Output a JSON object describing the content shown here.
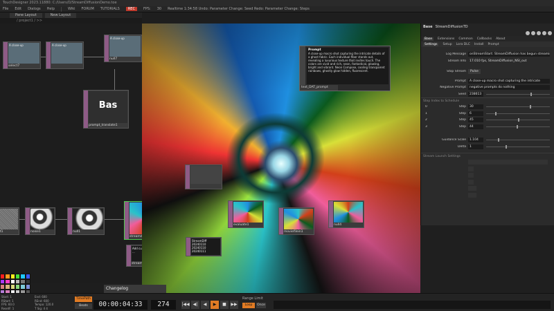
{
  "window": {
    "title": "TouchDesigner 2023.11880: C:/Users/D/StreamDiffusionDemo.toe"
  },
  "menubar": {
    "items": [
      "File",
      "Edit",
      "Dialogs",
      "Help",
      "Wiki",
      "FORUM",
      "TUTORIALS"
    ],
    "tag": "REC",
    "fps_label": "FPS:",
    "fps_value": "30",
    "status": "Realtime  1:34:58 Undo: Parameter Change: Seed  Redo: Parameter Change: Steps"
  },
  "panes": {
    "tab1": "Pane Layout",
    "tab2": "New Layout"
  },
  "path": "/ project1 / >>",
  "nodes": {
    "select7": {
      "text": "A close-up",
      "caption": "select7"
    },
    "select_b": {
      "text": "A close-up",
      "caption": ""
    },
    "null7": {
      "text": "A close-up",
      "caption": "null7"
    },
    "prompt": {
      "text": "Bas",
      "caption": "prompt_translate1"
    },
    "noise_left": {
      "caption": "rt1"
    },
    "noise1": {
      "caption": "noise1"
    },
    "null1": {
      "caption": "null1"
    },
    "streamdiffusion": {
      "caption": "streamdiffusion"
    },
    "callbacks": {
      "caption": "streamdiffusion_callbacks",
      "lines": [
        "Add custom",
        "..."
      ]
    },
    "table_node": {
      "lines": [
        "StreamDiff",
        "20240110",
        "20240110",
        "20240111"
      ]
    },
    "evaluate1": {
      "caption": "evaluate1"
    },
    "movie": {
      "caption": "moviefilein1"
    },
    "null4": {
      "caption": "null4"
    }
  },
  "prompt_doc": {
    "heading": "Prompt",
    "text": "A close-up macro shot capturing the intricate details of a ghost fabric. Each individual fiber stands out, revealing a luxurious texture that invites touch. The colors are vivid and rich, neon, fantastical, glowing, bright and vibrant. Neon Compose, cooling transparent rainbows, ghostly glow hidden, fluorescent.",
    "caption": "text_DAT_prompt"
  },
  "params": {
    "comp_type": "Base",
    "comp_name": "StreamDiffusionTD",
    "tabs": [
      "Base",
      "Extensions",
      "Common",
      "Callbacks",
      "About"
    ],
    "subtabs": [
      "Settings",
      "Setup",
      "Lora DLC",
      "Install",
      "Prompt"
    ],
    "rows": [
      {
        "label": "Log Message",
        "value": "onStreamStart: StreamDiffusion has begun streaming"
      },
      {
        "label": "Stream Info",
        "value": "17.010 fps, StreamDiffusion_NSI_out"
      },
      {
        "label": "Stop Stream",
        "value": "Pulse"
      },
      {
        "label": "Prompt",
        "value": "A close-up macro shot capturing the intricate"
      },
      {
        "label": "Negative Prompt",
        "value": "negative prompts do nothing"
      },
      {
        "label": "Seed",
        "value": "238613"
      }
    ],
    "steps_header": "Step Index to Schedule",
    "steps": [
      {
        "label": "0",
        "value": "30"
      },
      {
        "label": "1",
        "value": "6"
      },
      {
        "label": "2",
        "value": "45"
      },
      {
        "label": "3",
        "value": "44"
      }
    ],
    "steps_suffix": "Step",
    "guidance_label": "Guidance Scale",
    "guidance_value": "1.104",
    "delta_label": "Delta",
    "delta_value": "1",
    "stream_header": "Stream Launch Settings"
  },
  "lower": {
    "changelog": "Changelog"
  },
  "stats": [
    "Start: 1",
    "End: 600",
    "RStart: 1",
    "REnd: 600",
    "FPS: 60.0",
    "Tempo: 120.0",
    "ResetF: 1",
    "T Sig: 4 4"
  ],
  "palette": [
    "#ff1e1e",
    "#ff9a1e",
    "#ffef1e",
    "#48e03a",
    "#1ec7ff",
    "#3a58ff",
    "#aa3aff",
    "#ff3acb",
    "#ffffff",
    "#bbbbbb",
    "#777777",
    "#333333",
    "#d87d7d",
    "#d8b27d",
    "#d8d87d",
    "#8ad87d",
    "#7dcad8",
    "#7d8ed8",
    "#b47dd8",
    "#d87dbe",
    "#eeeeee",
    "#cccccc",
    "#999999",
    "#555555"
  ],
  "timeline": {
    "btn_timepath": "TimePath",
    "btn_beats": "Beats",
    "timecode": "00:00:04:33",
    "frame": "274",
    "transport": [
      "|◀◀",
      "◀|",
      "◀",
      "▶",
      "■",
      "▶▶"
    ],
    "range_label": "Range Limit",
    "range_loop": "Loop",
    "range_once": "Once"
  },
  "colors": {
    "accent": "#e07b24",
    "node_strip": "#8e5b86",
    "selected_node": "#4ecb4e"
  }
}
